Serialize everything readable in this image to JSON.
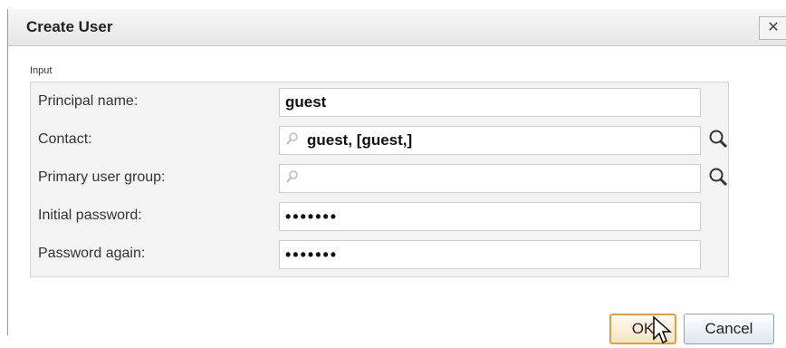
{
  "dialog": {
    "title": "Create User",
    "close_glyph": "✕"
  },
  "form": {
    "group_label": "Input",
    "fields": [
      {
        "label": "Principal name:",
        "value": "guest"
      },
      {
        "label": "Contact:",
        "value": "guest, [guest,]",
        "icon": "search-icon",
        "lookup": true
      },
      {
        "label": "Primary user group:",
        "value": "",
        "icon": "search-icon",
        "lookup": true
      },
      {
        "label": "Initial password:",
        "value": "•••••••",
        "masked": true
      },
      {
        "label": "Password again:",
        "value": "•••••••",
        "masked": true
      }
    ]
  },
  "buttons": {
    "ok": "OK",
    "cancel": "Cancel"
  }
}
